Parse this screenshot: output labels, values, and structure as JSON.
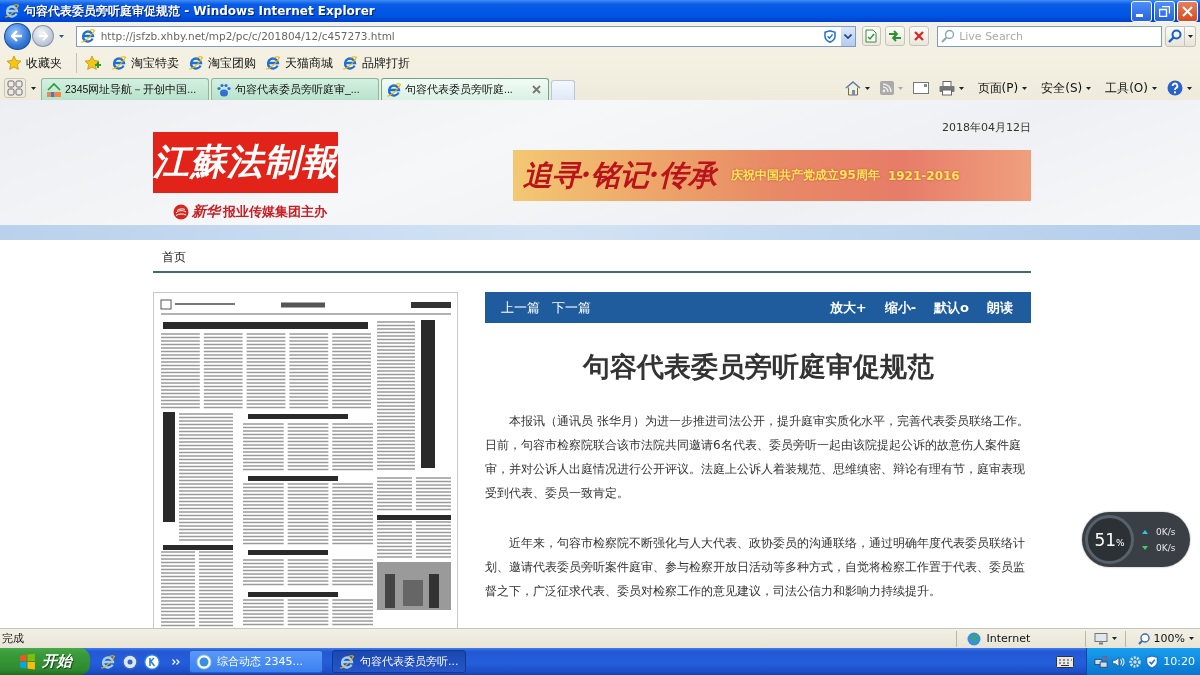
{
  "window": {
    "title": "句容代表委员旁听庭审促规范 - Windows Internet Explorer"
  },
  "address_bar": {
    "url": "http://jsfzb.xhby.net/mp2/pc/c/201804/12/c457273.html",
    "search_placeholder": "Live Search"
  },
  "favorites_bar": {
    "label": "收藏夹",
    "links": [
      "淘宝特卖",
      "淘宝团购",
      "天猫商城",
      "品牌打折"
    ]
  },
  "tabs": [
    {
      "label": "2345网址导航－开创中国...",
      "kind": "portal",
      "selected": false
    },
    {
      "label": "句容代表委员旁听庭审_...",
      "kind": "paw",
      "selected": false
    },
    {
      "label": "句容代表委员旁听庭...",
      "kind": "browser",
      "selected": true
    }
  ],
  "command_bar": {
    "menus": [
      "页面(P)",
      "安全(S)",
      "工具(O)"
    ]
  },
  "page": {
    "date": "2018年04月12日",
    "logo": "江蘇法制報",
    "publisher_brand": "新华",
    "publisher": "报业传媒集团主办",
    "banner": {
      "slogan": "追寻·铭记·传承",
      "caption": "庆祝中国共产党成立**95**周年",
      "years": "1921-2016"
    },
    "breadcrumb": "首页",
    "article_toolbar": {
      "nav": [
        "上一篇",
        "下一篇"
      ],
      "tools": [
        "放大+",
        "缩小-",
        "默认o",
        "朗读"
      ]
    },
    "article": {
      "title": "句容代表委员旁听庭审促规范",
      "paragraphs": [
        "本报讯（通讯员 张华月）为进一步推进司法公开，提升庭审实质化水平，完善代表委员联络工作。日前，句容市检察院联合该市法院共同邀请6名代表、委员旁听一起由该院提起公诉的故意伤人案件庭审，并对公诉人出庭情况进行公开评议。法庭上公诉人着装规范、思维缜密、辩论有理有节，庭审表现受到代表、委员一致肯定。",
        "近年来，句容市检察院不断强化与人大代表、政协委员的沟通联络，通过明确年度代表委员联络计划、邀请代表委员旁听案件庭审、参与检察开放日活动等多种方式，自觉将检察工作置于代表、委员监督之下，广泛征求代表、委员对检察工作的意见建议，司法公信力和影响力持续提升。"
      ]
    }
  },
  "speed_widget": {
    "value": "51",
    "unit": "%",
    "upload": "0K/s",
    "download": "0K/s"
  },
  "status_bar": {
    "text": "完成",
    "zone": "Internet",
    "zoom": "100%"
  },
  "taskbar": {
    "start": "开始",
    "tasks": [
      {
        "label": "综合动态 2345...",
        "kind": "ring",
        "selected": false
      },
      {
        "label": "句容代表委员旁听...",
        "kind": "browser",
        "selected": true
      }
    ],
    "clock": "10:20"
  }
}
